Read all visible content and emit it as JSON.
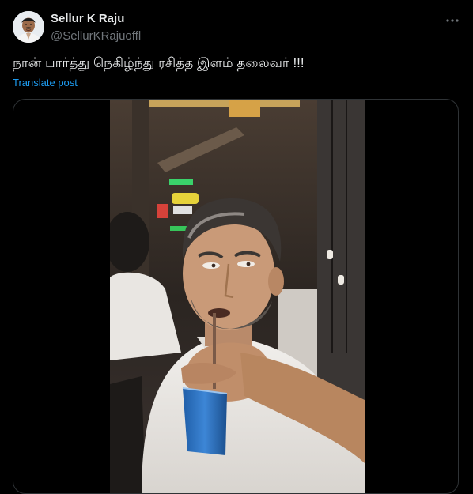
{
  "author": {
    "name": "Sellur K Raju",
    "handle": "@SellurKRajuoffl",
    "avatar_icon": "user-avatar"
  },
  "post": {
    "text": "நான் பார்த்து நெகிழ்ந்து ரசித்த  இளம் தலைவர் !!!",
    "translate_label": "Translate post"
  },
  "icons": {
    "more": "more-horizontal-icon"
  },
  "colors": {
    "background": "#000000",
    "text_primary": "#e7e9ea",
    "text_secondary": "#71767b",
    "link": "#1d9bf0",
    "border": "#2f3336"
  }
}
